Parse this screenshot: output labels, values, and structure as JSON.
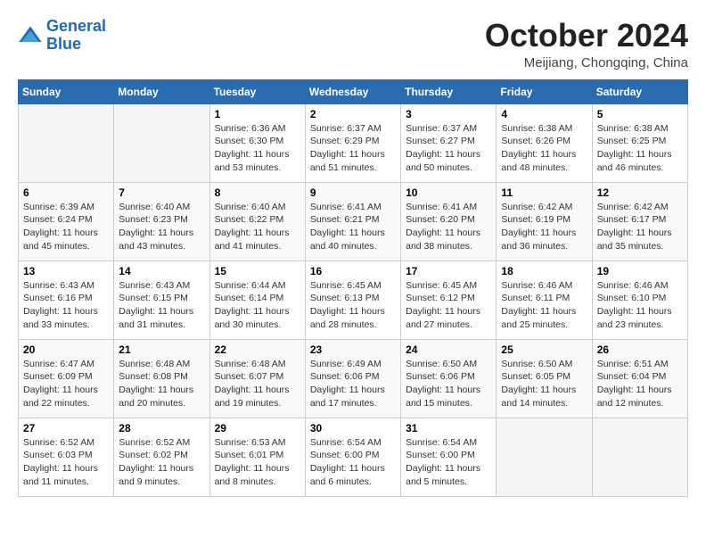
{
  "logo": {
    "line1": "General",
    "line2": "Blue"
  },
  "title": "October 2024",
  "location": "Meijiang, Chongqing, China",
  "days_of_week": [
    "Sunday",
    "Monday",
    "Tuesday",
    "Wednesday",
    "Thursday",
    "Friday",
    "Saturday"
  ],
  "weeks": [
    [
      {
        "day": "",
        "info": ""
      },
      {
        "day": "",
        "info": ""
      },
      {
        "day": "1",
        "info": "Sunrise: 6:36 AM\nSunset: 6:30 PM\nDaylight: 11 hours and 53 minutes."
      },
      {
        "day": "2",
        "info": "Sunrise: 6:37 AM\nSunset: 6:29 PM\nDaylight: 11 hours and 51 minutes."
      },
      {
        "day": "3",
        "info": "Sunrise: 6:37 AM\nSunset: 6:27 PM\nDaylight: 11 hours and 50 minutes."
      },
      {
        "day": "4",
        "info": "Sunrise: 6:38 AM\nSunset: 6:26 PM\nDaylight: 11 hours and 48 minutes."
      },
      {
        "day": "5",
        "info": "Sunrise: 6:38 AM\nSunset: 6:25 PM\nDaylight: 11 hours and 46 minutes."
      }
    ],
    [
      {
        "day": "6",
        "info": "Sunrise: 6:39 AM\nSunset: 6:24 PM\nDaylight: 11 hours and 45 minutes."
      },
      {
        "day": "7",
        "info": "Sunrise: 6:40 AM\nSunset: 6:23 PM\nDaylight: 11 hours and 43 minutes."
      },
      {
        "day": "8",
        "info": "Sunrise: 6:40 AM\nSunset: 6:22 PM\nDaylight: 11 hours and 41 minutes."
      },
      {
        "day": "9",
        "info": "Sunrise: 6:41 AM\nSunset: 6:21 PM\nDaylight: 11 hours and 40 minutes."
      },
      {
        "day": "10",
        "info": "Sunrise: 6:41 AM\nSunset: 6:20 PM\nDaylight: 11 hours and 38 minutes."
      },
      {
        "day": "11",
        "info": "Sunrise: 6:42 AM\nSunset: 6:19 PM\nDaylight: 11 hours and 36 minutes."
      },
      {
        "day": "12",
        "info": "Sunrise: 6:42 AM\nSunset: 6:17 PM\nDaylight: 11 hours and 35 minutes."
      }
    ],
    [
      {
        "day": "13",
        "info": "Sunrise: 6:43 AM\nSunset: 6:16 PM\nDaylight: 11 hours and 33 minutes."
      },
      {
        "day": "14",
        "info": "Sunrise: 6:43 AM\nSunset: 6:15 PM\nDaylight: 11 hours and 31 minutes."
      },
      {
        "day": "15",
        "info": "Sunrise: 6:44 AM\nSunset: 6:14 PM\nDaylight: 11 hours and 30 minutes."
      },
      {
        "day": "16",
        "info": "Sunrise: 6:45 AM\nSunset: 6:13 PM\nDaylight: 11 hours and 28 minutes."
      },
      {
        "day": "17",
        "info": "Sunrise: 6:45 AM\nSunset: 6:12 PM\nDaylight: 11 hours and 27 minutes."
      },
      {
        "day": "18",
        "info": "Sunrise: 6:46 AM\nSunset: 6:11 PM\nDaylight: 11 hours and 25 minutes."
      },
      {
        "day": "19",
        "info": "Sunrise: 6:46 AM\nSunset: 6:10 PM\nDaylight: 11 hours and 23 minutes."
      }
    ],
    [
      {
        "day": "20",
        "info": "Sunrise: 6:47 AM\nSunset: 6:09 PM\nDaylight: 11 hours and 22 minutes."
      },
      {
        "day": "21",
        "info": "Sunrise: 6:48 AM\nSunset: 6:08 PM\nDaylight: 11 hours and 20 minutes."
      },
      {
        "day": "22",
        "info": "Sunrise: 6:48 AM\nSunset: 6:07 PM\nDaylight: 11 hours and 19 minutes."
      },
      {
        "day": "23",
        "info": "Sunrise: 6:49 AM\nSunset: 6:06 PM\nDaylight: 11 hours and 17 minutes."
      },
      {
        "day": "24",
        "info": "Sunrise: 6:50 AM\nSunset: 6:06 PM\nDaylight: 11 hours and 15 minutes."
      },
      {
        "day": "25",
        "info": "Sunrise: 6:50 AM\nSunset: 6:05 PM\nDaylight: 11 hours and 14 minutes."
      },
      {
        "day": "26",
        "info": "Sunrise: 6:51 AM\nSunset: 6:04 PM\nDaylight: 11 hours and 12 minutes."
      }
    ],
    [
      {
        "day": "27",
        "info": "Sunrise: 6:52 AM\nSunset: 6:03 PM\nDaylight: 11 hours and 11 minutes."
      },
      {
        "day": "28",
        "info": "Sunrise: 6:52 AM\nSunset: 6:02 PM\nDaylight: 11 hours and 9 minutes."
      },
      {
        "day": "29",
        "info": "Sunrise: 6:53 AM\nSunset: 6:01 PM\nDaylight: 11 hours and 8 minutes."
      },
      {
        "day": "30",
        "info": "Sunrise: 6:54 AM\nSunset: 6:00 PM\nDaylight: 11 hours and 6 minutes."
      },
      {
        "day": "31",
        "info": "Sunrise: 6:54 AM\nSunset: 6:00 PM\nDaylight: 11 hours and 5 minutes."
      },
      {
        "day": "",
        "info": ""
      },
      {
        "day": "",
        "info": ""
      }
    ]
  ]
}
